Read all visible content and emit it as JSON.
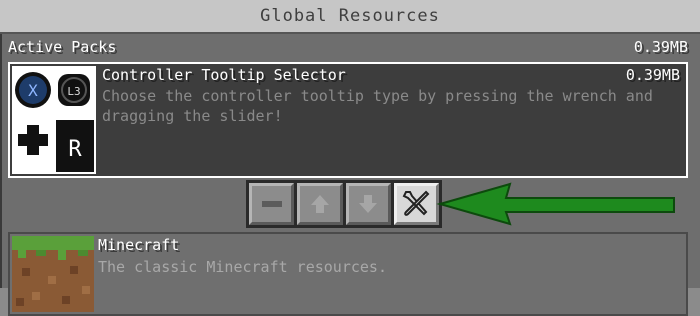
{
  "window": {
    "title": "Global Resources"
  },
  "active_packs": {
    "title": "Active Packs",
    "total_size": "0.39MB",
    "items": [
      {
        "name": "Controller Tooltip Selector",
        "size": "0.39MB",
        "description": "Choose the controller tooltip type by pressing the wrench and dragging the slider!",
        "icon_glyphs": {
          "x_button": "X",
          "l3_button": "L3",
          "r_button": "R"
        }
      }
    ]
  },
  "controls": {
    "buttons": [
      {
        "icon": "minus-icon"
      },
      {
        "icon": "arrow-up-icon"
      },
      {
        "icon": "arrow-down-icon"
      },
      {
        "icon": "wrench-screwdriver-icon"
      }
    ]
  },
  "available_packs": {
    "items": [
      {
        "name": "Minecraft",
        "description": "The classic Minecraft resources.",
        "icon": "grass-block-icon"
      }
    ]
  },
  "colors": {
    "panel": "#6e6e6e",
    "titlebar": "#c6c6c6",
    "arrow": "#1e8a1e",
    "selection_border": "#ffffff"
  }
}
